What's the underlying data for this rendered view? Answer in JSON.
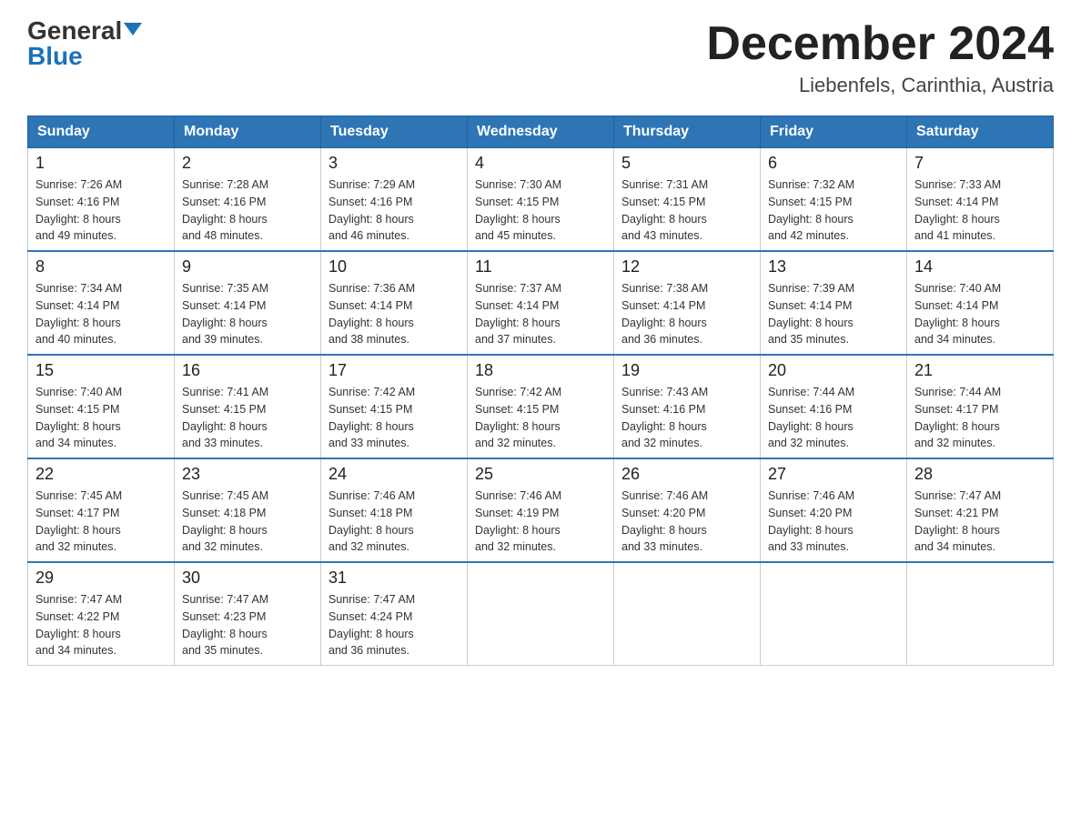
{
  "logo": {
    "general": "General",
    "blue": "Blue"
  },
  "title": "December 2024",
  "location": "Liebenfels, Carinthia, Austria",
  "days_of_week": [
    "Sunday",
    "Monday",
    "Tuesday",
    "Wednesday",
    "Thursday",
    "Friday",
    "Saturday"
  ],
  "weeks": [
    [
      {
        "day": "1",
        "sunrise": "7:26 AM",
        "sunset": "4:16 PM",
        "daylight": "8 hours and 49 minutes."
      },
      {
        "day": "2",
        "sunrise": "7:28 AM",
        "sunset": "4:16 PM",
        "daylight": "8 hours and 48 minutes."
      },
      {
        "day": "3",
        "sunrise": "7:29 AM",
        "sunset": "4:16 PM",
        "daylight": "8 hours and 46 minutes."
      },
      {
        "day": "4",
        "sunrise": "7:30 AM",
        "sunset": "4:15 PM",
        "daylight": "8 hours and 45 minutes."
      },
      {
        "day": "5",
        "sunrise": "7:31 AM",
        "sunset": "4:15 PM",
        "daylight": "8 hours and 43 minutes."
      },
      {
        "day": "6",
        "sunrise": "7:32 AM",
        "sunset": "4:15 PM",
        "daylight": "8 hours and 42 minutes."
      },
      {
        "day": "7",
        "sunrise": "7:33 AM",
        "sunset": "4:14 PM",
        "daylight": "8 hours and 41 minutes."
      }
    ],
    [
      {
        "day": "8",
        "sunrise": "7:34 AM",
        "sunset": "4:14 PM",
        "daylight": "8 hours and 40 minutes."
      },
      {
        "day": "9",
        "sunrise": "7:35 AM",
        "sunset": "4:14 PM",
        "daylight": "8 hours and 39 minutes."
      },
      {
        "day": "10",
        "sunrise": "7:36 AM",
        "sunset": "4:14 PM",
        "daylight": "8 hours and 38 minutes."
      },
      {
        "day": "11",
        "sunrise": "7:37 AM",
        "sunset": "4:14 PM",
        "daylight": "8 hours and 37 minutes."
      },
      {
        "day": "12",
        "sunrise": "7:38 AM",
        "sunset": "4:14 PM",
        "daylight": "8 hours and 36 minutes."
      },
      {
        "day": "13",
        "sunrise": "7:39 AM",
        "sunset": "4:14 PM",
        "daylight": "8 hours and 35 minutes."
      },
      {
        "day": "14",
        "sunrise": "7:40 AM",
        "sunset": "4:14 PM",
        "daylight": "8 hours and 34 minutes."
      }
    ],
    [
      {
        "day": "15",
        "sunrise": "7:40 AM",
        "sunset": "4:15 PM",
        "daylight": "8 hours and 34 minutes."
      },
      {
        "day": "16",
        "sunrise": "7:41 AM",
        "sunset": "4:15 PM",
        "daylight": "8 hours and 33 minutes."
      },
      {
        "day": "17",
        "sunrise": "7:42 AM",
        "sunset": "4:15 PM",
        "daylight": "8 hours and 33 minutes."
      },
      {
        "day": "18",
        "sunrise": "7:42 AM",
        "sunset": "4:15 PM",
        "daylight": "8 hours and 32 minutes."
      },
      {
        "day": "19",
        "sunrise": "7:43 AM",
        "sunset": "4:16 PM",
        "daylight": "8 hours and 32 minutes."
      },
      {
        "day": "20",
        "sunrise": "7:44 AM",
        "sunset": "4:16 PM",
        "daylight": "8 hours and 32 minutes."
      },
      {
        "day": "21",
        "sunrise": "7:44 AM",
        "sunset": "4:17 PM",
        "daylight": "8 hours and 32 minutes."
      }
    ],
    [
      {
        "day": "22",
        "sunrise": "7:45 AM",
        "sunset": "4:17 PM",
        "daylight": "8 hours and 32 minutes."
      },
      {
        "day": "23",
        "sunrise": "7:45 AM",
        "sunset": "4:18 PM",
        "daylight": "8 hours and 32 minutes."
      },
      {
        "day": "24",
        "sunrise": "7:46 AM",
        "sunset": "4:18 PM",
        "daylight": "8 hours and 32 minutes."
      },
      {
        "day": "25",
        "sunrise": "7:46 AM",
        "sunset": "4:19 PM",
        "daylight": "8 hours and 32 minutes."
      },
      {
        "day": "26",
        "sunrise": "7:46 AM",
        "sunset": "4:20 PM",
        "daylight": "8 hours and 33 minutes."
      },
      {
        "day": "27",
        "sunrise": "7:46 AM",
        "sunset": "4:20 PM",
        "daylight": "8 hours and 33 minutes."
      },
      {
        "day": "28",
        "sunrise": "7:47 AM",
        "sunset": "4:21 PM",
        "daylight": "8 hours and 34 minutes."
      }
    ],
    [
      {
        "day": "29",
        "sunrise": "7:47 AM",
        "sunset": "4:22 PM",
        "daylight": "8 hours and 34 minutes."
      },
      {
        "day": "30",
        "sunrise": "7:47 AM",
        "sunset": "4:23 PM",
        "daylight": "8 hours and 35 minutes."
      },
      {
        "day": "31",
        "sunrise": "7:47 AM",
        "sunset": "4:24 PM",
        "daylight": "8 hours and 36 minutes."
      },
      null,
      null,
      null,
      null
    ]
  ],
  "labels": {
    "sunrise": "Sunrise:",
    "sunset": "Sunset:",
    "daylight": "Daylight:"
  }
}
